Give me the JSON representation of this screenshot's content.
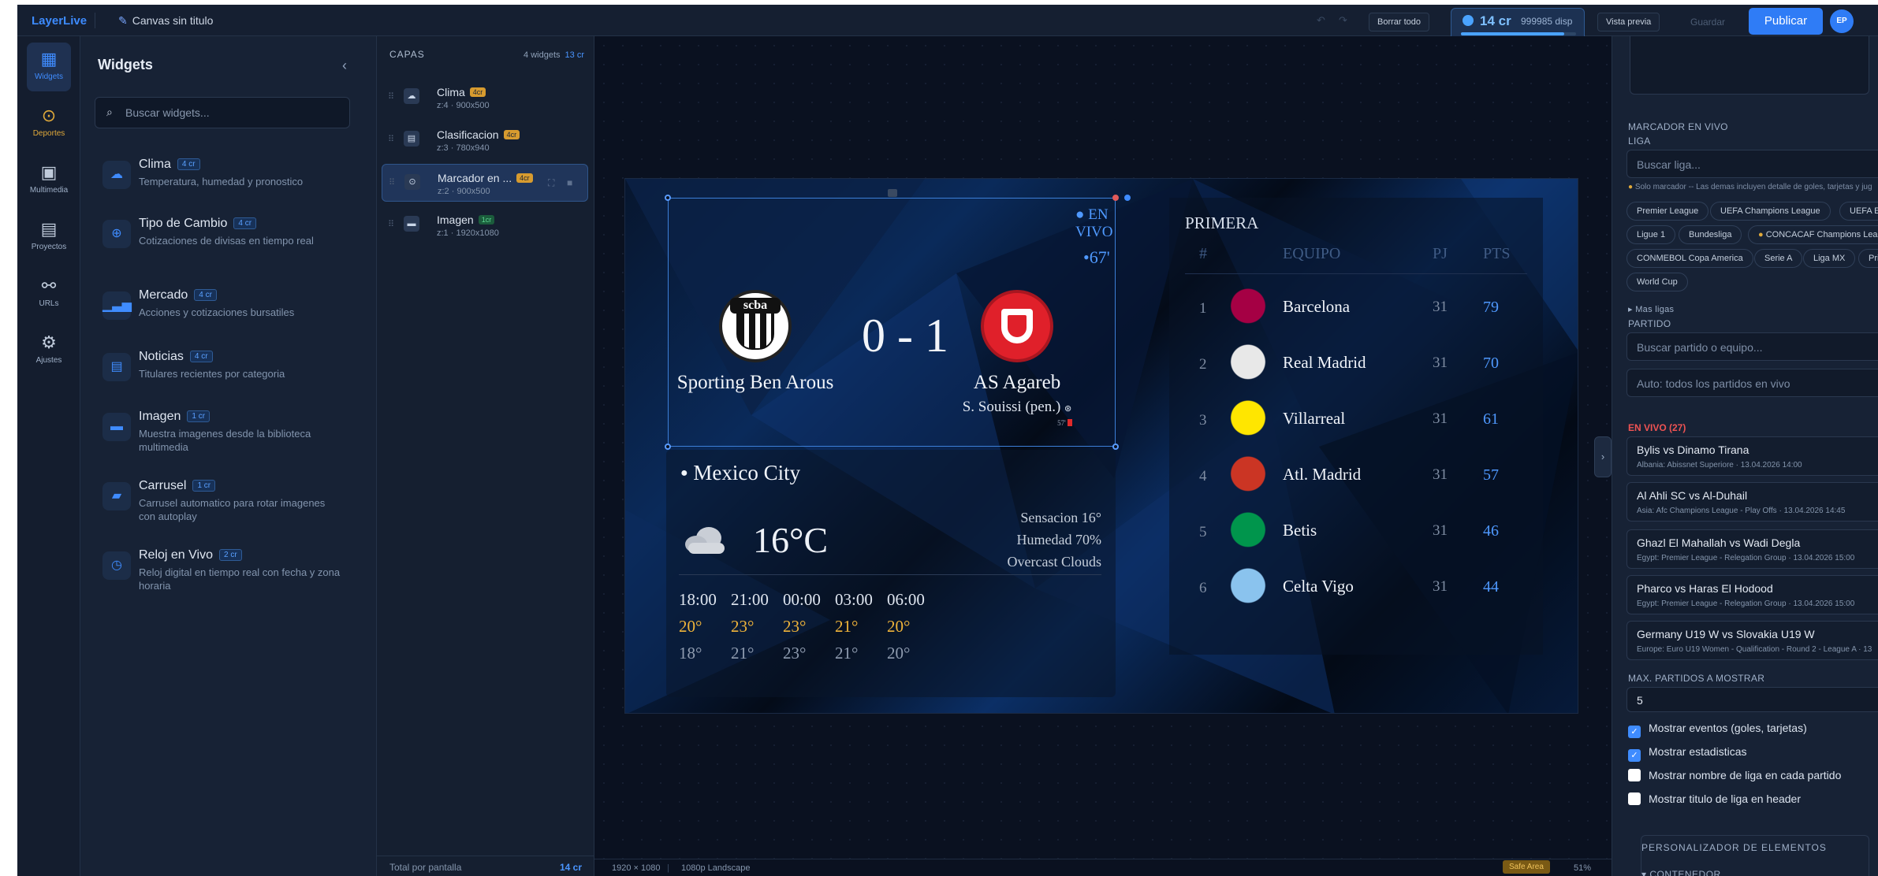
{
  "app": {
    "logo": "LayerLive",
    "canvas_title": "Canvas sin titulo"
  },
  "topbar": {
    "clear_all": "Borrar todo",
    "credits_amount": "14 cr",
    "credits_available": "999985 disp",
    "credits_fill": 0.9,
    "preview": "Vista previa",
    "save": "Guardar",
    "publish": "Publicar",
    "avatar": "EP"
  },
  "iconbar": [
    {
      "label": "Widgets",
      "icon": "grid-icon"
    },
    {
      "label": "Deportes",
      "icon": "soccer-icon"
    },
    {
      "label": "Multimedia",
      "icon": "image-icon"
    },
    {
      "label": "Proyectos",
      "icon": "document-icon"
    },
    {
      "label": "URLs",
      "icon": "link-icon"
    },
    {
      "label": "Ajustes",
      "icon": "gear-icon"
    }
  ],
  "widgets_panel": {
    "title": "Widgets",
    "search_placeholder": "Buscar widgets...",
    "items": [
      {
        "name": "Clima",
        "credits": "4 cr",
        "desc": "Temperatura, humedad y pronostico",
        "icon": "weather-icon"
      },
      {
        "name": "Tipo de Cambio",
        "credits": "4 cr",
        "desc": "Cotizaciones de divisas en tiempo real",
        "icon": "currency-icon"
      },
      {
        "name": "Mercado",
        "credits": "4 cr",
        "desc": "Acciones y cotizaciones bursatiles",
        "icon": "bar-chart-icon"
      },
      {
        "name": "Noticias",
        "credits": "4 cr",
        "desc": "Titulares recientes por categoria",
        "icon": "news-icon"
      },
      {
        "name": "Imagen",
        "credits": "1 cr",
        "desc": "Muestra imagenes desde la biblioteca multimedia",
        "icon": "image-icon"
      },
      {
        "name": "Carrusel",
        "credits": "1 cr",
        "desc": "Carrusel automatico para rotar imagenes con autoplay",
        "icon": "carousel-icon"
      },
      {
        "name": "Reloj en Vivo",
        "credits": "2 cr",
        "desc": "Reloj digital en tiempo real con fecha y zona horaria",
        "icon": "clock-icon"
      }
    ]
  },
  "layers_panel": {
    "title": "CAPAS",
    "count": "4 widgets",
    "credits": "13 cr",
    "items": [
      {
        "name": "Clima",
        "credits": "4cr",
        "meta": "z:4 · 900x500"
      },
      {
        "name": "Clasificacion",
        "credits": "4cr",
        "meta": "z:3 · 780x940"
      },
      {
        "name": "Marcador en ...",
        "credits": "4cr",
        "meta": "z:2 · 900x500"
      },
      {
        "name": "Imagen",
        "credits": "1cr",
        "meta": "z:1 · 1920x1080"
      }
    ],
    "footer_label": "Total por pantalla",
    "footer_value": "14 cr"
  },
  "scoreboard": {
    "live": "EN VIVO",
    "minute": "67'",
    "home_team": "Sporting Ben Arous",
    "home_crest": "scba",
    "away_team": "AS Agareb",
    "score": "0 - 1",
    "scorer": "S. Souissi (pen.)",
    "scorer_minute": "57'"
  },
  "weather": {
    "city": "Mexico City",
    "temp": "16°C",
    "feels": "Sensacion 16°",
    "humidity": "Humedad 70%",
    "condition": "Overcast Clouds",
    "forecast": [
      {
        "hour": "18:00",
        "hi": "20°",
        "lo": "18°"
      },
      {
        "hour": "21:00",
        "hi": "23°",
        "lo": "21°"
      },
      {
        "hour": "00:00",
        "hi": "23°",
        "lo": "23°"
      },
      {
        "hour": "03:00",
        "hi": "21°",
        "lo": "21°"
      },
      {
        "hour": "06:00",
        "hi": "20°",
        "lo": "20°"
      }
    ]
  },
  "standings": {
    "league": "PRIMERA",
    "col_pos": "#",
    "col_team": "EQUIPO",
    "col_pj": "PJ",
    "col_pts": "PTS",
    "rows": [
      {
        "pos": "1",
        "team": "Barcelona",
        "pj": "31",
        "pts": "79",
        "color": "#a50044"
      },
      {
        "pos": "2",
        "team": "Real Madrid",
        "pj": "31",
        "pts": "70",
        "color": "#e8e8e8"
      },
      {
        "pos": "3",
        "team": "Villarreal",
        "pj": "31",
        "pts": "61",
        "color": "#ffe600"
      },
      {
        "pos": "4",
        "team": "Atl. Madrid",
        "pj": "31",
        "pts": "57",
        "color": "#cb3524"
      },
      {
        "pos": "5",
        "team": "Betis",
        "pj": "31",
        "pts": "46",
        "color": "#00954c"
      },
      {
        "pos": "6",
        "team": "Celta Vigo",
        "pj": "31",
        "pts": "44",
        "color": "#8ac3ee"
      }
    ]
  },
  "statusbar": {
    "size": "1920 × 1080",
    "preset": "1080p Landscape",
    "safe_area": "Safe Area",
    "zoom": "51%"
  },
  "right_panel": {
    "section": "MARCADOR EN VIVO",
    "liga_label": "LIGA",
    "liga_placeholder": "Buscar liga...",
    "note": "Solo marcador -- Las demas incluyen detalle de goles, tarjetas y jug",
    "leagues": [
      "Premier League",
      "UEFA Champions League",
      "UEFA Eu",
      "Ligue 1",
      "Bundesliga",
      "CONCACAF Champions Leag",
      "CONMEBOL Copa America",
      "Serie A",
      "Liga MX",
      "Pri",
      "World Cup"
    ],
    "more": "Mas ligas",
    "partido_label": "PARTIDO",
    "partido_placeholder": "Buscar partido o equipo...",
    "auto": "Auto: todos los partidos en vivo",
    "live_count": "EN VIVO (27)",
    "matches": [
      {
        "title": "Bylis vs Dinamo Tirana",
        "sub": "Albania: Abissnet Superiore · 13.04.2026 14:00"
      },
      {
        "title": "Al Ahli SC vs Al-Duhail",
        "sub": "Asia: Afc Champions League - Play Offs · 13.04.2026 14:45"
      },
      {
        "title": "Ghazl El Mahallah vs Wadi Degla",
        "sub": "Egypt: Premier League - Relegation Group · 13.04.2026 15:00"
      },
      {
        "title": "Pharco vs Haras El Hodood",
        "sub": "Egypt: Premier League - Relegation Group · 13.04.2026 15:00"
      },
      {
        "title": "Germany U19 W vs Slovakia U19 W",
        "sub": "Europe: Euro U19 Women - Qualification - Round 2 - League A · 13"
      }
    ],
    "max_label": "MAX. PARTIDOS A MOSTRAR",
    "max_value": "5",
    "checks": [
      {
        "label": "Mostrar eventos (goles, tarjetas)",
        "on": true
      },
      {
        "label": "Mostrar estadisticas",
        "on": true
      },
      {
        "label": "Mostrar nombre de liga en cada partido",
        "on": false
      },
      {
        "label": "Mostrar titulo de liga en header",
        "on": false
      }
    ],
    "personalizer": "PERSONALIZADOR DE ELEMENTOS",
    "container": "CONTENEDOR"
  }
}
